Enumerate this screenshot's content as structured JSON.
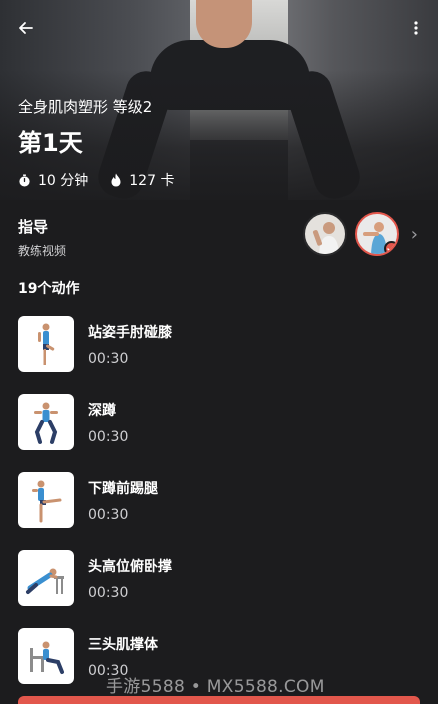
{
  "header": {
    "plan_name": "全身肌肉塑形 等级2",
    "day_title": "第1天",
    "duration": "10 分钟",
    "calories": "127 卡"
  },
  "coach": {
    "title": "指导",
    "subtitle": "教练视频"
  },
  "exercise_count": "19个动作",
  "exercises": [
    {
      "name": "站姿手肘碰膝",
      "duration": "00:30"
    },
    {
      "name": "深蹲",
      "duration": "00:30"
    },
    {
      "name": "下蹲前踢腿",
      "duration": "00:30"
    },
    {
      "name": "头高位俯卧撑",
      "duration": "00:30"
    },
    {
      "name": "三头肌撑体",
      "duration": "00:30"
    }
  ],
  "watermark": "手游5588 • MX5588.COM",
  "colors": {
    "accent": "#e2574c",
    "background": "#1c1c1e"
  },
  "icons": {
    "back": "arrow-left-icon",
    "more": "more-vertical-icon",
    "duration": "timer-icon",
    "calories": "flame-icon",
    "chevron": "chevron-right-icon",
    "check": "check-icon"
  }
}
